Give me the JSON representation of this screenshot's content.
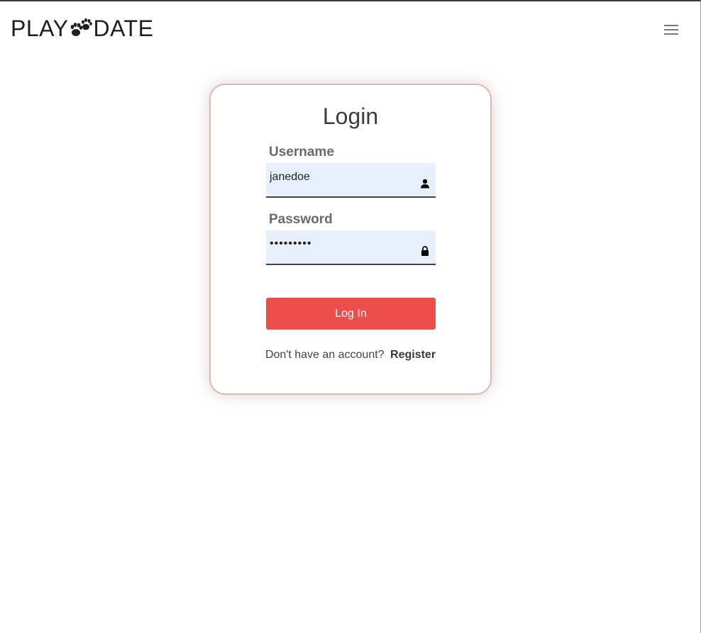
{
  "brand": {
    "left_text": "PLAY",
    "right_text": "DATE",
    "icon": "paw-icon"
  },
  "navbar": {
    "menu_icon": "hamburger-menu-icon"
  },
  "login": {
    "title": "Login",
    "username": {
      "label": "Username",
      "value": "janedoe",
      "icon": "user-icon"
    },
    "password": {
      "label": "Password",
      "value": "•••••••••",
      "icon": "lock-icon"
    },
    "submit_label": "Log In",
    "register_prompt": "Don't have an account?",
    "register_link": "Register"
  },
  "colors": {
    "accent": "#ec4f4b",
    "input_bg": "#e8f0fe",
    "card_border": "#d7b9b9"
  }
}
